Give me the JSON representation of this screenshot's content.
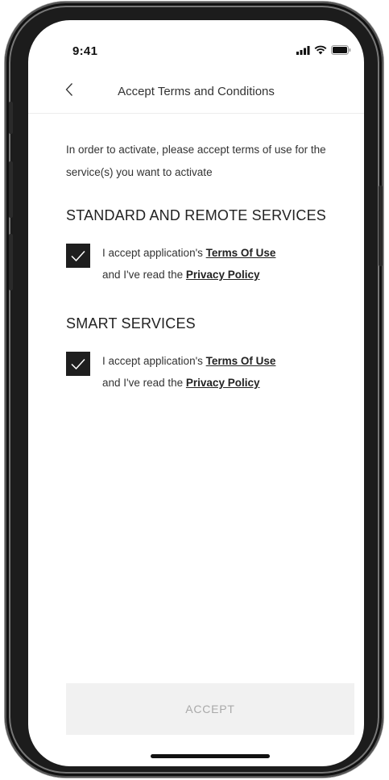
{
  "status_bar": {
    "time": "9:41"
  },
  "nav": {
    "title": "Accept Terms and Conditions",
    "back_icon": "chevron-left-icon"
  },
  "intro": "In order to activate, please accept terms of use for the service(s) you want to activate",
  "sections": [
    {
      "heading": "STANDARD AND REMOTE SERVICES",
      "checked": true,
      "line1_prefix": "I accept application's ",
      "line1_link": "Terms Of Use",
      "line2_prefix": "and I've read the ",
      "line2_link": "Privacy Policy"
    },
    {
      "heading": "SMART SERVICES",
      "checked": true,
      "line1_prefix": "I accept application's ",
      "line1_link": "Terms Of Use",
      "line2_prefix": "and I've read the ",
      "line2_link": "Privacy Policy"
    }
  ],
  "accept_button": {
    "label": "ACCEPT",
    "enabled": false
  },
  "colors": {
    "checkbox": "#1e1e1e",
    "button_bg": "#f1f1f1",
    "button_text": "#a9a9a9"
  }
}
